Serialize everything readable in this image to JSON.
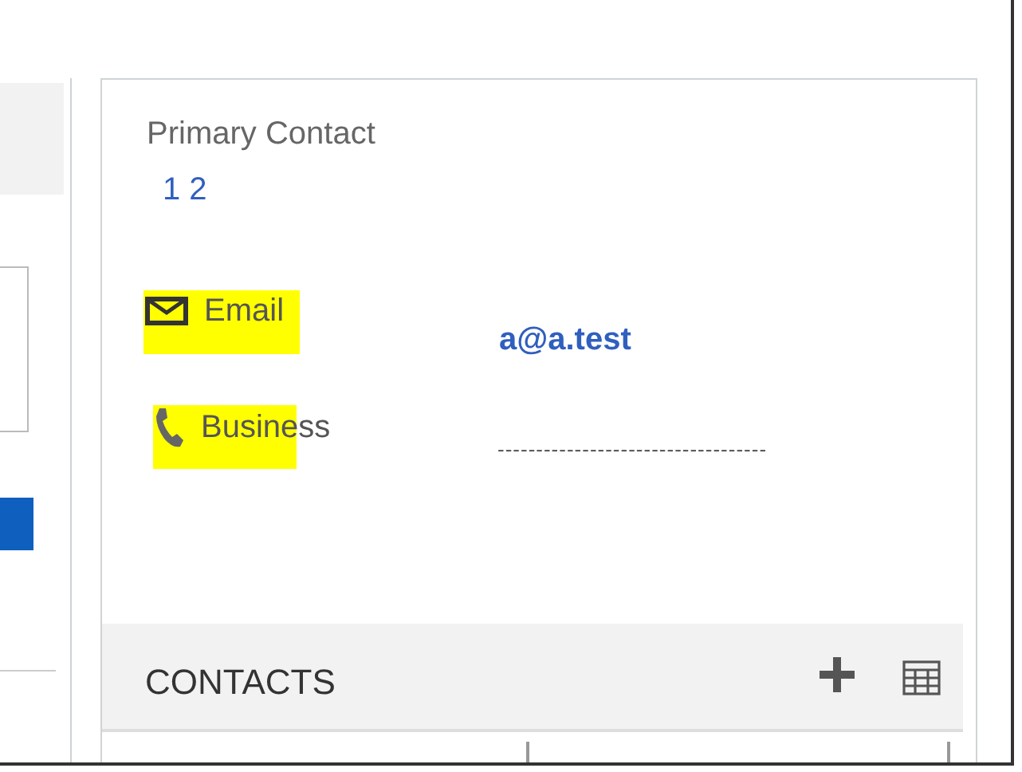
{
  "primary_contact": {
    "label": "Primary Contact",
    "value": "1 2"
  },
  "fields": [
    {
      "kind": "email",
      "label": "Email",
      "value": "a@a.test",
      "highlighted": true
    },
    {
      "kind": "phone",
      "label": "Business",
      "value": "-----------------------------------",
      "highlighted": true
    }
  ],
  "contacts": {
    "title": "CONTACTS"
  }
}
